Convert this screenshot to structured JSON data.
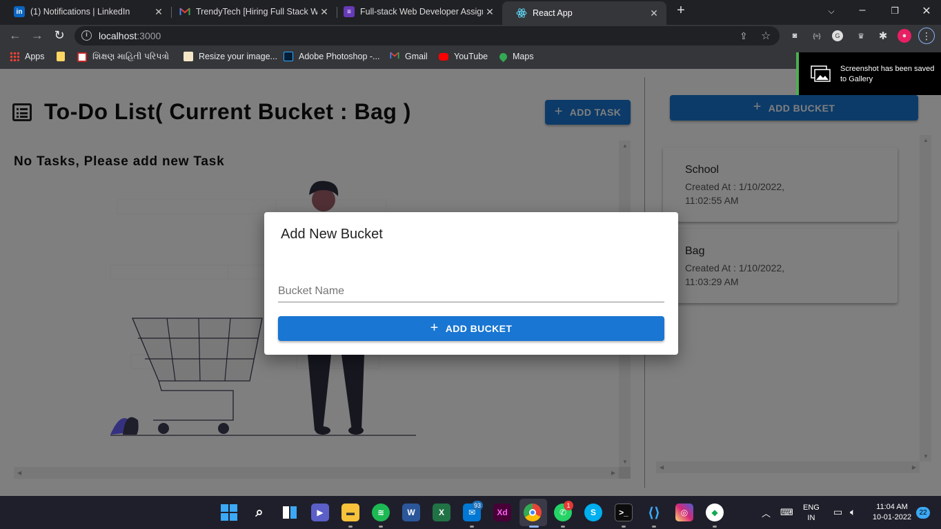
{
  "browser": {
    "tabs": [
      {
        "title": "(1) Notifications | LinkedIn",
        "icon": "linkedin-icon",
        "active": false
      },
      {
        "title": "TrendyTech [Hiring Full Stack Web",
        "icon": "gmail-icon",
        "active": false
      },
      {
        "title": "Full-stack Web Developer Assignm",
        "icon": "forms-icon",
        "active": false
      },
      {
        "title": "React App",
        "icon": "react-icon",
        "active": true
      }
    ],
    "url_host": "localhost",
    "url_port": ":3000",
    "bookmarks": [
      "Apps",
      "",
      "શિક્ષણ માહિતી પરિપત્રો",
      "Resize your image...",
      "Adobe Photoshop -...",
      "Gmail",
      "YouTube",
      "Maps"
    ]
  },
  "toast": {
    "text": "Screenshot has been saved to Gallery"
  },
  "app": {
    "heading": "To-Do List( Current Bucket : Bag )",
    "add_task_label": "ADD TASK",
    "add_bucket_label": "ADD BUCKET",
    "empty_message": "No Tasks, Please add new Task",
    "buckets": [
      {
        "name": "School",
        "created": "Created At : 1/10/2022, 11:02:55 AM"
      },
      {
        "name": "Bag",
        "created": "Created At : 1/10/2022, 11:03:29 AM"
      }
    ]
  },
  "dialog": {
    "title": "Add New Bucket",
    "field_label": "Bucket Name",
    "field_value": "",
    "submit_label": "ADD BUCKET"
  },
  "taskbar": {
    "mail_badge": "93",
    "whatsapp_badge": "1",
    "lang_top": "ENG",
    "lang_bottom": "IN",
    "time": "11:04 AM",
    "date": "10-01-2022",
    "notif_count": "22"
  },
  "colors": {
    "primary": "#1976d2",
    "toast_accent": "#4caf50",
    "illustration_accent": "#6c63ff"
  }
}
